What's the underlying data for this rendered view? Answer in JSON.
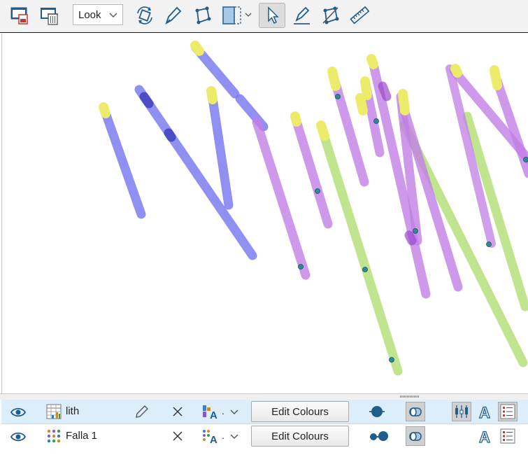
{
  "toolbar": {
    "view_mode": "Look"
  },
  "legend_rows": [
    {
      "name": "lith",
      "button": "Edit Colours"
    },
    {
      "name": "Falla 1",
      "button": "Edit Colours"
    }
  ],
  "colors": {
    "purple": "#c27ee6",
    "green": "#b5e07a",
    "blue": "#7b7cf0",
    "yellow": "#ecec6a",
    "accent": "#1f5d8c"
  }
}
